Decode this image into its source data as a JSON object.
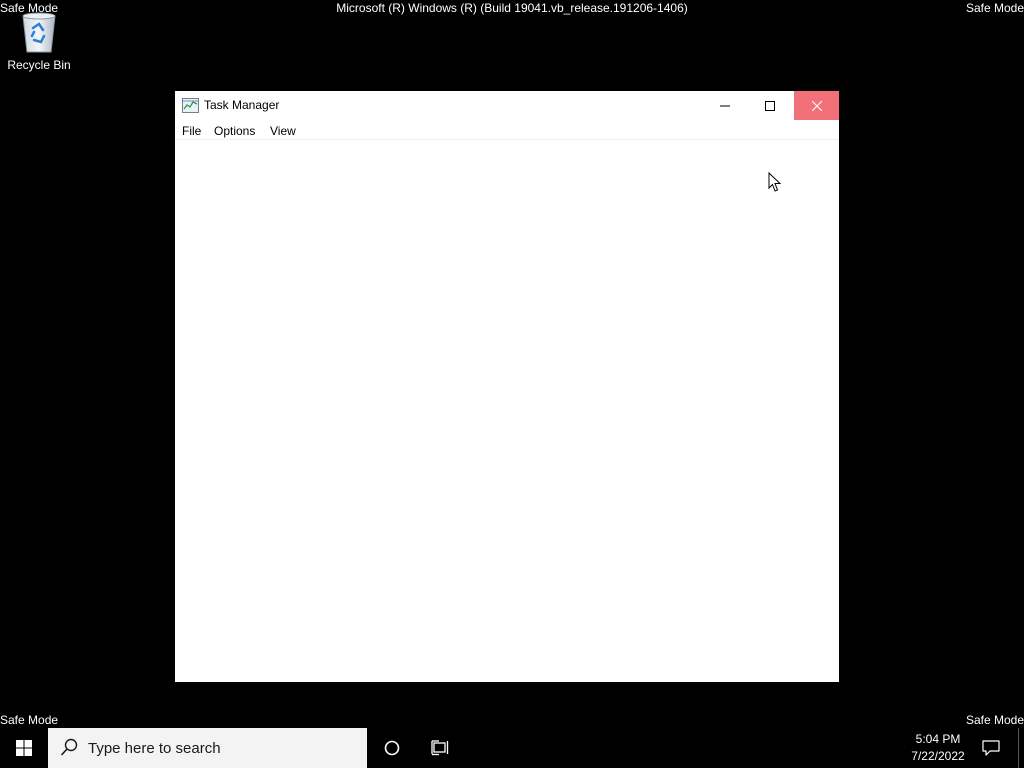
{
  "watermark": {
    "safe_mode": "Safe Mode",
    "build": "Microsoft (R) Windows (R) (Build 19041.vb_release.191206-1406)"
  },
  "desktop": {
    "icons": [
      {
        "label": "Recycle Bin",
        "icon": "recycle-bin-icon"
      }
    ]
  },
  "window": {
    "title": "Task Manager",
    "icon": "task-manager-icon",
    "menu": [
      "File",
      "Options",
      "View"
    ],
    "close_hover_color": "#f1707a"
  },
  "taskbar": {
    "search_placeholder": "Type here to search",
    "time": "5:04 PM",
    "date": "7/22/2022"
  }
}
